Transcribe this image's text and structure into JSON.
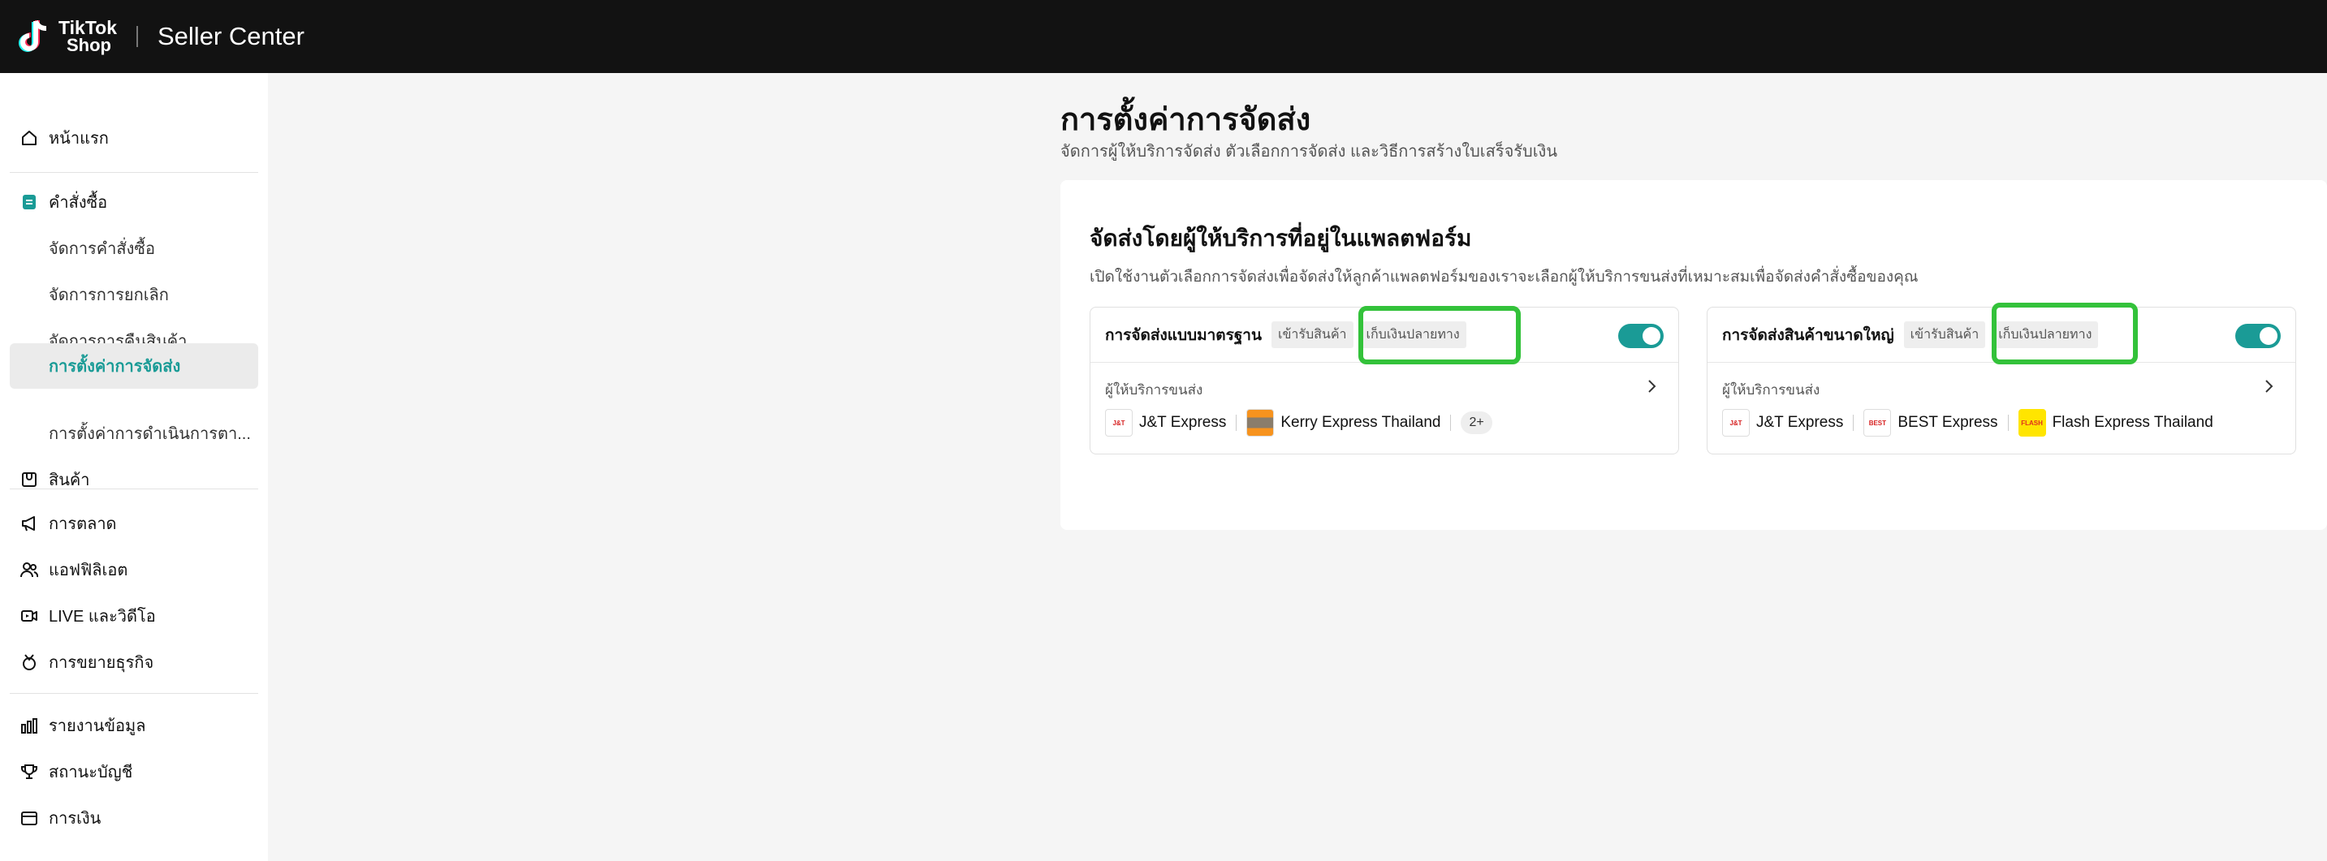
{
  "header": {
    "logo_line1": "TikTok",
    "logo_line2": "Shop",
    "app_title": "Seller Center"
  },
  "sidebar": {
    "items": [
      {
        "label": "หน้าแรก",
        "icon": "home-icon"
      },
      {
        "label": "คำสั่งซื้อ",
        "icon": "orders-icon"
      },
      {
        "label": "จัดการคำสั่งซื้อ"
      },
      {
        "label": "จัดการการยกเลิก"
      },
      {
        "label": "จัดการการคืนสินค้า"
      },
      {
        "label": "การตั้งค่าการจัดส่ง"
      },
      {
        "label": "การตั้งค่าการดำเนินการตา..."
      },
      {
        "label": "สินค้า",
        "icon": "product-icon"
      },
      {
        "label": "การตลาด",
        "icon": "megaphone-icon"
      },
      {
        "label": "แอฟฟิลิเอต",
        "icon": "affiliate-icon"
      },
      {
        "label": "LIVE และวิดีโอ",
        "icon": "video-icon"
      },
      {
        "label": "การขยายธุรกิจ",
        "icon": "growth-icon"
      },
      {
        "label": "รายงานข้อมูล",
        "icon": "chart-icon"
      },
      {
        "label": "สถานะบัญชี",
        "icon": "trophy-icon"
      },
      {
        "label": "การเงิน",
        "icon": "wallet-icon"
      }
    ],
    "active_color": "#1a9b96"
  },
  "main": {
    "title": "การตั้งค่าการจัดส่ง",
    "subtitle": "จัดการผู้ให้บริการจัดส่ง ตัวเลือกการจัดส่ง และวิธีการสร้างใบเสร็จรับเงิน",
    "panel": {
      "title": "จัดส่งโดยผู้ให้บริการที่อยู่ในแพลตฟอร์ม",
      "description": "เปิดใช้งานตัวเลือกการจัดส่งเพื่อจัดส่งให้ลูกค้าแพลตฟอร์มของเราจะเลือกผู้ให้บริการขนส่งที่เหมาะสมเพื่อจัดส่งคำสั่งซื้อของคุณ",
      "cards": [
        {
          "title": "การจัดส่งแบบมาตรฐาน",
          "tags": [
            "เข้ารับสินค้า",
            "เก็บเงินปลายทาง"
          ],
          "toggle_on": true,
          "carrier_label": "ผู้ให้บริการขนส่ง",
          "carriers": [
            "J&T Express",
            "Kerry Express Thailand"
          ],
          "more": "2+"
        },
        {
          "title": "การจัดส่งสินค้าขนาดใหญ่",
          "tags": [
            "เข้ารับสินค้า",
            "เก็บเงินปลายทาง"
          ],
          "toggle_on": true,
          "carrier_label": "ผู้ให้บริการขนส่ง",
          "carriers": [
            "J&T Express",
            "BEST Express",
            "Flash Express Thailand"
          ]
        }
      ]
    }
  },
  "logo_marks": {
    "jt": "J&T",
    "best": "BEST",
    "flash": "FLASH"
  },
  "colors": {
    "highlight": "#33c23a",
    "toggle": "#1a9b96",
    "topbar": "#121212"
  }
}
